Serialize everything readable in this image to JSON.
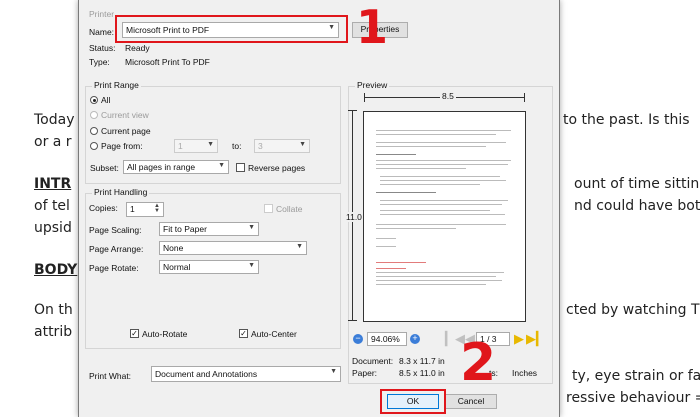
{
  "document": {
    "lines": [
      "Today",
      "or a r",
      "INTR",
      "of tel",
      "upsid",
      "BODY",
      "On th",
      "attrib",
      "to the past. Is this",
      "ount of time sitting",
      "nd could have both",
      "cted by watching T",
      "ty, eye strain or fat",
      "ressive behaviour ="
    ]
  },
  "printer": {
    "section": "Printer",
    "name_label": "Name:",
    "name_value": "Microsoft Print to PDF",
    "properties_label": "Properties",
    "status_label": "Status:",
    "status_value": "Ready",
    "type_label": "Type:",
    "type_value": "Microsoft Print To PDF"
  },
  "print_range": {
    "title": "Print Range",
    "all": "All",
    "current_view": "Current view",
    "current_page": "Current page",
    "page_from": "Page from:",
    "from_value": "1",
    "to_label": "to:",
    "to_value": "3",
    "subset_label": "Subset:",
    "subset_value": "All pages in range",
    "reverse_pages": "Reverse pages"
  },
  "print_handling": {
    "title": "Print Handling",
    "copies_label": "Copies:",
    "copies_value": "1",
    "collate": "Collate",
    "page_scaling_label": "Page Scaling:",
    "page_scaling_value": "Fit to Paper",
    "page_arrange_label": "Page Arrange:",
    "page_arrange_value": "None",
    "page_rotate_label": "Page Rotate:",
    "page_rotate_value": "Normal",
    "auto_rotate": "Auto-Rotate",
    "auto_center": "Auto-Center"
  },
  "print_what": {
    "label": "Print What:",
    "value": "Document and Annotations"
  },
  "preview": {
    "title": "Preview",
    "width": "8.5",
    "height": "11.0",
    "zoom": "94.06%",
    "page": "1 / 3",
    "document_label": "Document:",
    "document_size": "8.3 x 11.7 in",
    "paper_label": "Paper:",
    "paper_size": "8.5 x 11.0 in",
    "units_partial": "ts:",
    "units_value": "Inches"
  },
  "buttons": {
    "ok": "OK",
    "cancel": "Cancel"
  },
  "annotations": {
    "step1": "1",
    "step2": "2"
  },
  "colors": {
    "highlight": "#e0161b"
  }
}
